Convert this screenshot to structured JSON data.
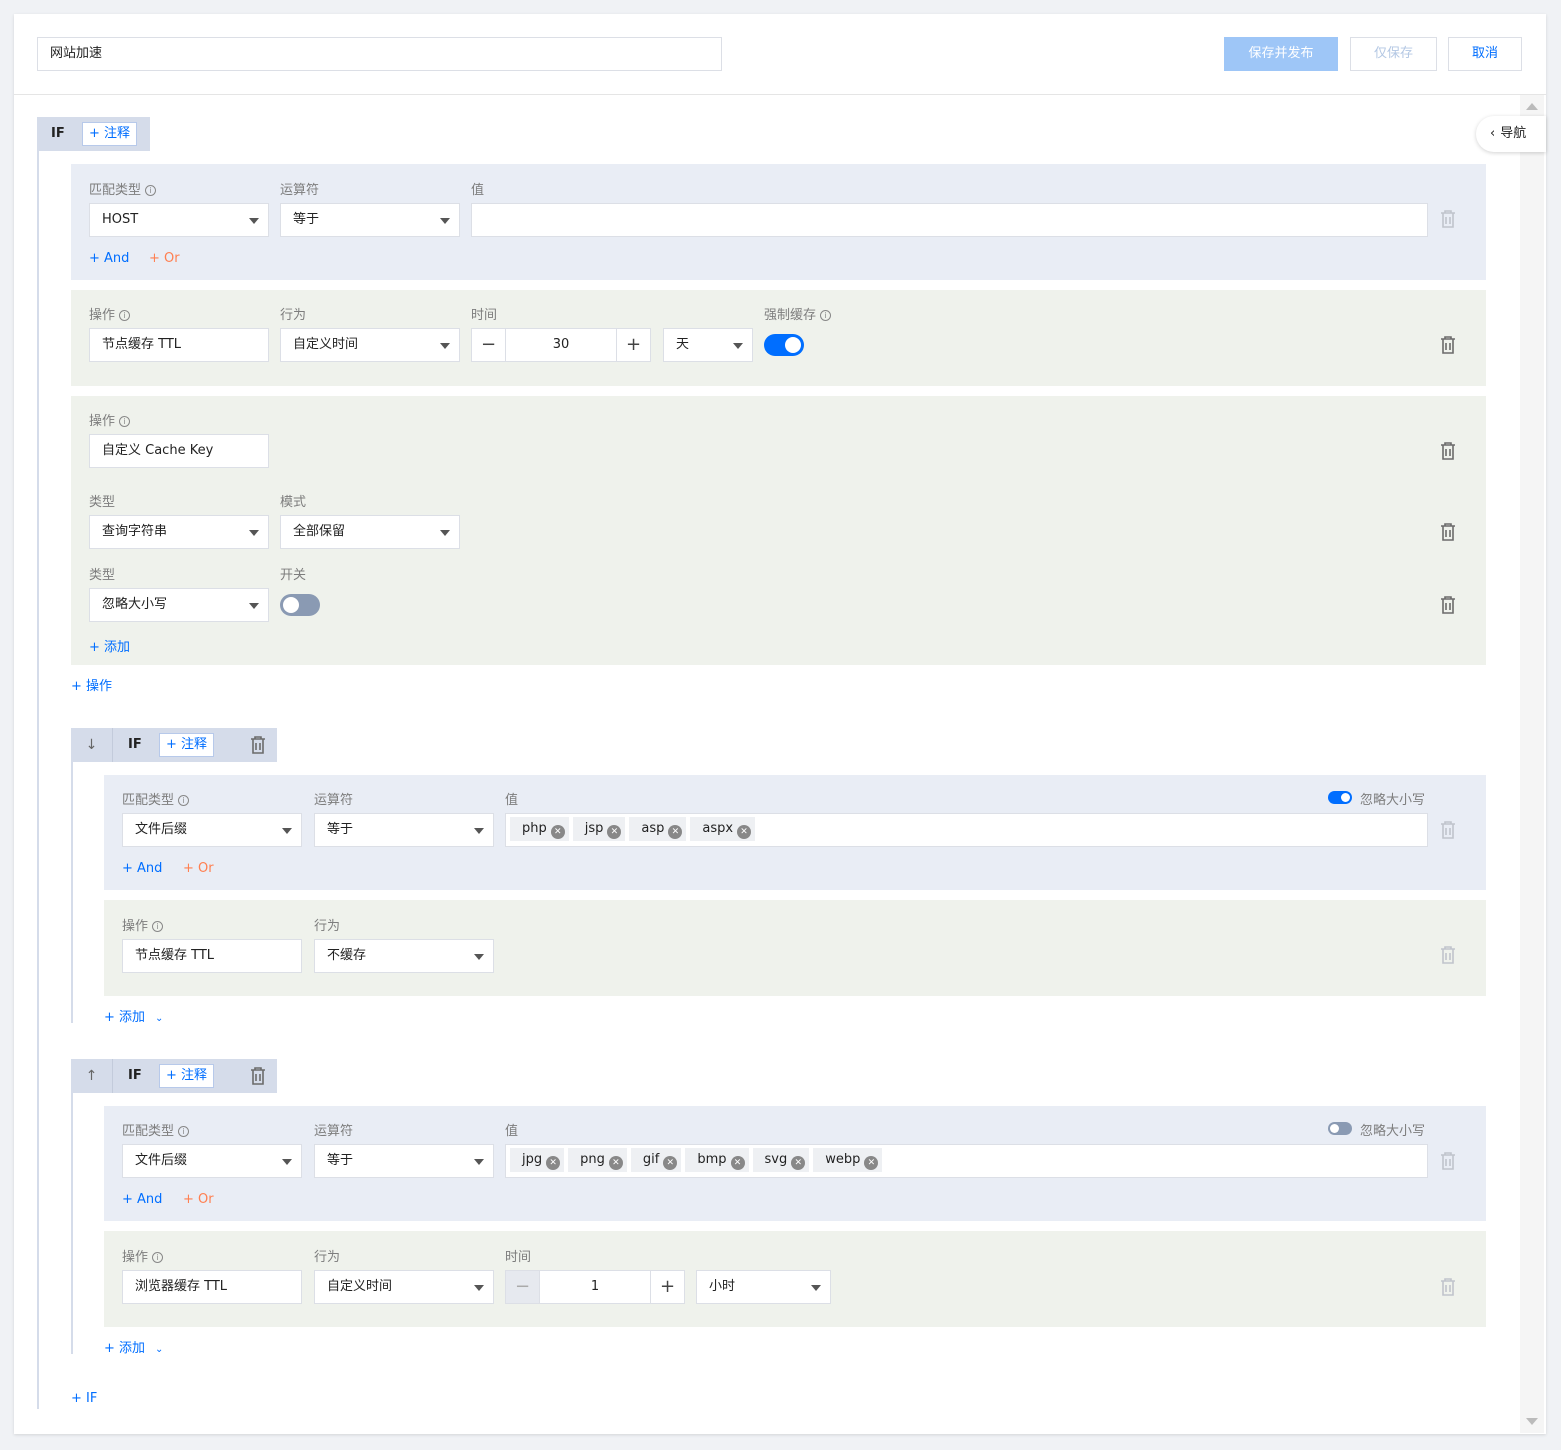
{
  "header": {
    "name_value": "网站加速",
    "save_publish_label": "保存并发布",
    "save_only_label": "仅保存",
    "cancel_label": "取消"
  },
  "nav_label": "导航",
  "common": {
    "if_label": "IF",
    "note_label": "+ 注释",
    "and_label": "+ And",
    "or_label": "+ Or",
    "add_label": "+ 添加",
    "add_action_label": "+ 操作",
    "add_if_label": "+ IF",
    "info_glyph": "i",
    "tag_close": "✕"
  },
  "labels": {
    "match_type": "匹配类型",
    "operator": "运算符",
    "value": "值",
    "operation": "操作",
    "behavior": "行为",
    "time": "时间",
    "force_cache": "强制缓存",
    "type": "类型",
    "mode": "模式",
    "switch": "开关",
    "ignore_case": "忽略大小写"
  },
  "rule1": {
    "condition": {
      "match_type": "HOST",
      "operator": "等于",
      "value": ""
    },
    "action_ttl": {
      "operation": "节点缓存 TTL",
      "behavior": "自定义时间",
      "time": "30",
      "unit": "天",
      "force_cache": true
    },
    "action_cachekey": {
      "operation": "自定义 Cache Key",
      "row1": {
        "type": "查询字符串",
        "mode": "全部保留"
      },
      "row2": {
        "type": "忽略大小写",
        "switch": false
      }
    }
  },
  "rule2": {
    "condition": {
      "match_type": "文件后缀",
      "operator": "等于",
      "values": [
        "php",
        "jsp",
        "asp",
        "aspx"
      ],
      "ignore_case": true
    },
    "action": {
      "operation": "节点缓存 TTL",
      "behavior": "不缓存"
    }
  },
  "rule3": {
    "condition": {
      "match_type": "文件后缀",
      "operator": "等于",
      "values": [
        "jpg",
        "png",
        "gif",
        "bmp",
        "svg",
        "webp"
      ],
      "ignore_case": false
    },
    "action": {
      "operation": "浏览器缓存 TTL",
      "behavior": "自定义时间",
      "time": "1",
      "unit": "小时"
    }
  }
}
